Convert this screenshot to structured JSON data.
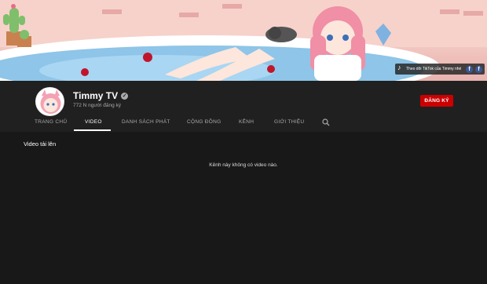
{
  "banner": {
    "social_text": "Theo dõi TikTok của Timmy nhé",
    "facebook_label_1": "f",
    "facebook_label_2": "f"
  },
  "channel": {
    "name": "Timmy TV",
    "subscribers": "772 N người đăng ký",
    "subscribe_label": "ĐĂNG KÝ"
  },
  "tabs": [
    {
      "label": "TRANG CHỦ"
    },
    {
      "label": "VIDEO"
    },
    {
      "label": "DANH SÁCH PHÁT"
    },
    {
      "label": "CỘNG ĐỒNG"
    },
    {
      "label": "KÊNH"
    },
    {
      "label": "GIỚI THIỆU"
    }
  ],
  "content": {
    "section_title": "Video tải lên",
    "empty_message": "Kênh này không có video nào."
  },
  "colors": {
    "background": "#181818",
    "header": "#202020",
    "subscribe": "#cc0000"
  }
}
